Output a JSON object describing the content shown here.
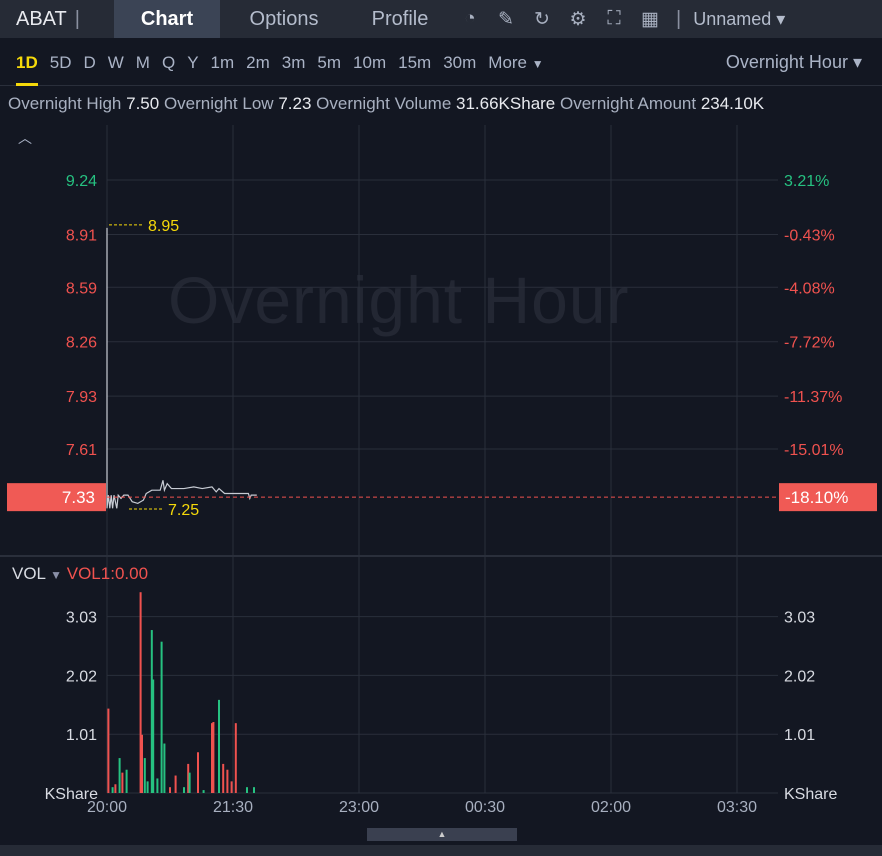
{
  "header": {
    "symbol": "ABAT",
    "tabs": [
      "Chart",
      "Options",
      "Profile"
    ],
    "active_tab": "Chart",
    "layout_name": "Unnamed"
  },
  "icons": [
    "indicator-icon",
    "draw-icon",
    "refresh-icon",
    "settings-icon",
    "fullscreen-icon",
    "layout-grid-icon"
  ],
  "timeframes": [
    "1D",
    "5D",
    "D",
    "W",
    "M",
    "Q",
    "Y",
    "1m",
    "2m",
    "3m",
    "5m",
    "10m",
    "15m",
    "30m",
    "More"
  ],
  "active_timeframe": "1D",
  "session_select": "Overnight Hour",
  "stats": {
    "high_label": "Overnight High",
    "high": "7.50",
    "low_label": "Overnight Low",
    "low": "7.23",
    "volume_label": "Overnight Volume",
    "volume": "31.66KShare",
    "amount_label": "Overnight Amount",
    "amount": "234.10K"
  },
  "watermark": "Overnight Hour",
  "colors": {
    "up": "#26c281",
    "down": "#f0524f",
    "accent": "#f5d90a"
  },
  "chart_data": {
    "type": "line",
    "price_axis": {
      "left": [
        "9.24",
        "8.91",
        "8.59",
        "8.26",
        "7.93",
        "7.61"
      ],
      "right": [
        "3.21%",
        "-0.43%",
        "-4.08%",
        "-7.72%",
        "-11.37%",
        "-15.01%"
      ],
      "ylim": [
        7.1,
        9.5
      ]
    },
    "current_price": "7.33",
    "current_change": "-18.10%",
    "max_label": "8.95",
    "min_label": "7.25",
    "x_ticks": [
      "20:00",
      "21:30",
      "23:00",
      "00:30",
      "02:00",
      "03:30"
    ],
    "price_series": [
      [
        0,
        8.95
      ],
      [
        0,
        7.25
      ],
      [
        1,
        7.33
      ],
      [
        2,
        7.25
      ],
      [
        3,
        7.33
      ],
      [
        4,
        7.25
      ],
      [
        5,
        7.33
      ],
      [
        7,
        7.25
      ],
      [
        8,
        7.33
      ],
      [
        10,
        7.31
      ],
      [
        12,
        7.33
      ],
      [
        15,
        7.33
      ],
      [
        18,
        7.29
      ],
      [
        22,
        7.28
      ],
      [
        26,
        7.3
      ],
      [
        28,
        7.34
      ],
      [
        32,
        7.36
      ],
      [
        38,
        7.36
      ],
      [
        40,
        7.42
      ],
      [
        41,
        7.36
      ],
      [
        43,
        7.4
      ],
      [
        46,
        7.37
      ],
      [
        55,
        7.37
      ],
      [
        62,
        7.38
      ],
      [
        68,
        7.37
      ],
      [
        75,
        7.38
      ],
      [
        78,
        7.35
      ],
      [
        80,
        7.37
      ],
      [
        84,
        7.34
      ],
      [
        95,
        7.34
      ],
      [
        101,
        7.34
      ],
      [
        102,
        7.31
      ],
      [
        103,
        7.33
      ],
      [
        107,
        7.33
      ]
    ],
    "volume": {
      "label": "VOL",
      "indicator": "VOL1:0.00",
      "unit": "KShare",
      "ticks": [
        "3.03",
        "2.02",
        "1.01"
      ],
      "ylim": [
        0,
        3.6
      ],
      "bars": [
        [
          1,
          1.45,
          "d"
        ],
        [
          4,
          0.1,
          "u"
        ],
        [
          6,
          0.15,
          "d"
        ],
        [
          9,
          0.6,
          "u"
        ],
        [
          11,
          0.35,
          "d"
        ],
        [
          14,
          0.4,
          "u"
        ],
        [
          24,
          3.45,
          "d"
        ],
        [
          25,
          1.0,
          "d"
        ],
        [
          27,
          0.6,
          "u"
        ],
        [
          29,
          0.2,
          "u"
        ],
        [
          32,
          2.8,
          "u"
        ],
        [
          33,
          1.95,
          "u"
        ],
        [
          36,
          0.25,
          "u"
        ],
        [
          39,
          2.6,
          "u"
        ],
        [
          41,
          0.85,
          "u"
        ],
        [
          45,
          0.1,
          "d"
        ],
        [
          49,
          0.3,
          "d"
        ],
        [
          55,
          0.1,
          "u"
        ],
        [
          58,
          0.5,
          "d"
        ],
        [
          59,
          0.35,
          "u"
        ],
        [
          65,
          0.7,
          "d"
        ],
        [
          69,
          0.05,
          "u"
        ],
        [
          75,
          1.2,
          "d"
        ],
        [
          76,
          1.22,
          "d"
        ],
        [
          80,
          1.6,
          "u"
        ],
        [
          83,
          0.5,
          "d"
        ],
        [
          86,
          0.4,
          "d"
        ],
        [
          89,
          0.2,
          "d"
        ],
        [
          92,
          1.2,
          "d"
        ],
        [
          100,
          0.1,
          "u"
        ],
        [
          105,
          0.1,
          "u"
        ]
      ]
    }
  }
}
